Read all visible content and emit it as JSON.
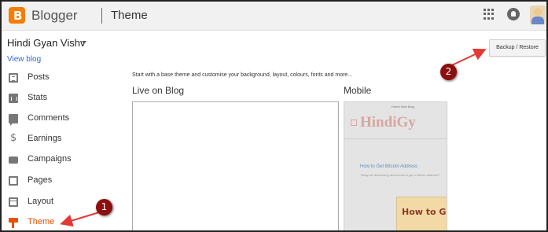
{
  "header": {
    "app_name": "Blogger",
    "logo_letter": "B",
    "page_title": "Theme",
    "icons": [
      "apps-grid-icon",
      "notifications-icon",
      "avatar"
    ]
  },
  "sidebar": {
    "blog_name": "Hindi Gyan Vishv",
    "view_blog": "View blog",
    "items": [
      {
        "label": "Posts",
        "icon": "posts-icon"
      },
      {
        "label": "Stats",
        "icon": "stats-icon"
      },
      {
        "label": "Comments",
        "icon": "comments-icon"
      },
      {
        "label": "Earnings",
        "icon": "dollar-icon"
      },
      {
        "label": "Campaigns",
        "icon": "campaigns-icon"
      },
      {
        "label": "Pages",
        "icon": "pages-icon"
      },
      {
        "label": "Layout",
        "icon": "layout-icon"
      },
      {
        "label": "Theme",
        "icon": "paint-roller-icon",
        "active": true
      }
    ],
    "dollar_glyph": "$"
  },
  "main": {
    "intro": "Start with a base theme and customise your background, layout, colours, fonts and more...",
    "live_label": "Live on Blog",
    "mobile_label": "Mobile",
    "backup_button": "Backup / Restore"
  },
  "mobile_preview": {
    "top_text": "Home   New Blog",
    "title": "HindiGy",
    "post_title": "How to Get Bitcoin Address",
    "post_text": "Today we discussing about how to get a bitcoin address?",
    "thumb_text": "How to G"
  },
  "annotations": {
    "badge_1": "1",
    "badge_2": "2"
  },
  "colors": {
    "accent": "#e65100",
    "link": "#3367d6",
    "annotation": "#8b0f0f",
    "arrow": "#e53935"
  }
}
